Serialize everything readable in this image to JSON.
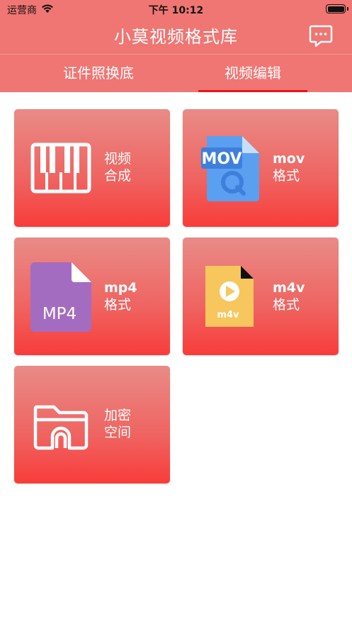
{
  "status_bar": {
    "carrier": "运营商",
    "time": "下午 10:12",
    "battery_level": 1.0
  },
  "header": {
    "title": "小莫视频格式库",
    "message_icon": "chat-bubble-icon"
  },
  "tabs": [
    {
      "label": "证件照换底",
      "selected": false
    },
    {
      "label": "视频编辑",
      "selected": true
    }
  ],
  "colors": {
    "header_bg": "#ef7673",
    "tab_indicator": "#e8161b",
    "card_gradient_top": "#e98b87",
    "card_gradient_bottom": "#f83c3a"
  },
  "tiles": [
    {
      "line1": "视频",
      "line2": "合成",
      "icon": "piano-keys-icon"
    },
    {
      "line1": "mov",
      "line2": "格式",
      "icon": "mov-file-icon",
      "icon_text": "MOV"
    },
    {
      "line1": "mp4",
      "line2": "格式",
      "icon": "mp4-file-icon",
      "icon_text": "MP4"
    },
    {
      "line1": "m4v",
      "line2": "格式",
      "icon": "m4v-file-icon",
      "icon_text": "m4v"
    },
    {
      "line1": "加密",
      "line2": "空间",
      "icon": "locked-folder-icon"
    }
  ]
}
